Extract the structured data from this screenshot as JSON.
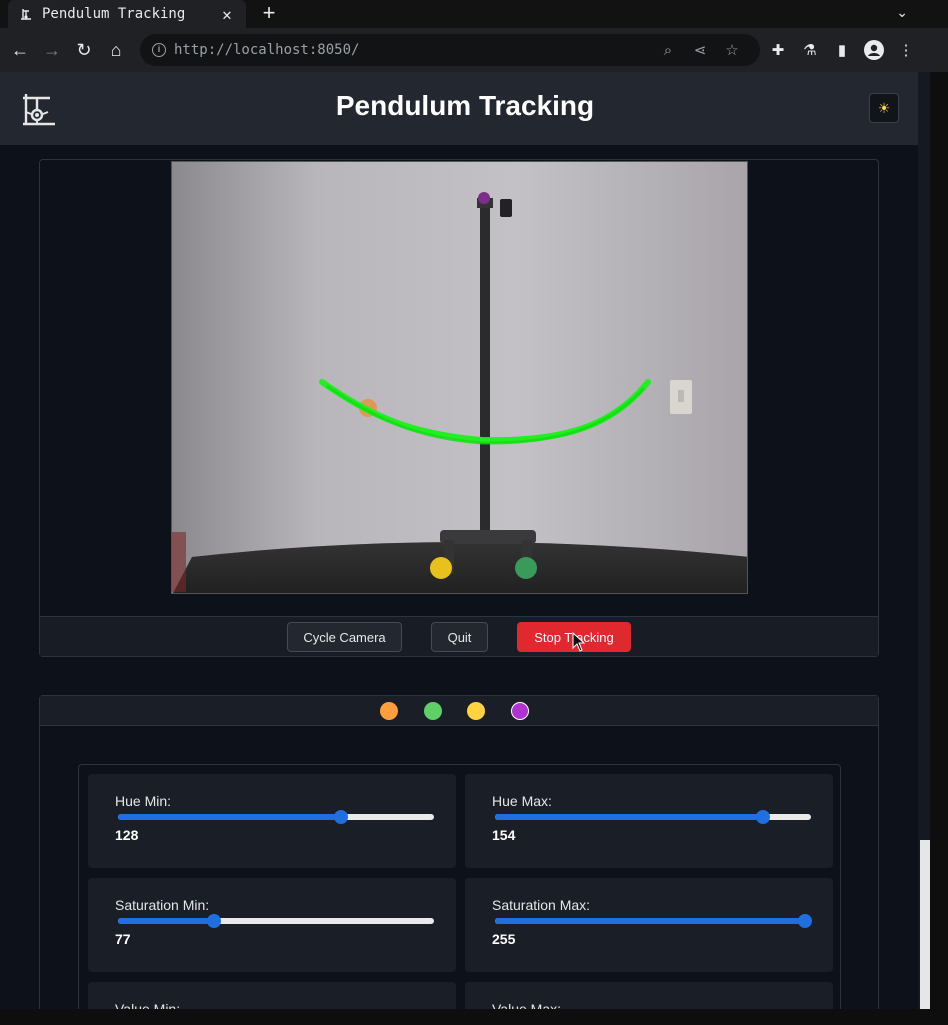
{
  "browser": {
    "tab_title": "Pendulum Tracking",
    "url": "http://localhost:8050/"
  },
  "header": {
    "title": "Pendulum Tracking",
    "theme_icon": "sun-icon"
  },
  "video": {
    "description_icon": "camera-feed"
  },
  "controls": {
    "cycle_camera": "Cycle Camera",
    "quit": "Quit",
    "stop_tracking": "Stop Tracking"
  },
  "colors": {
    "accent": "#1f6fe0",
    "danger": "#e0282e",
    "swatches": [
      "#ff9e3d",
      "#5fd068",
      "#ffd23f",
      "#b033d1"
    ]
  },
  "sliders": {
    "hue_min": {
      "label": "Hue Min:",
      "value": "128",
      "fraction": 0.705
    },
    "hue_max": {
      "label": "Hue Max:",
      "value": "154",
      "fraction": 0.848
    },
    "sat_min": {
      "label": "Saturation Min:",
      "value": "77",
      "fraction": 0.303
    },
    "sat_max": {
      "label": "Saturation Max:",
      "value": "255",
      "fraction": 0.98
    },
    "val_min": {
      "label": "Value Min:"
    },
    "val_max": {
      "label": "Value Max:"
    }
  }
}
